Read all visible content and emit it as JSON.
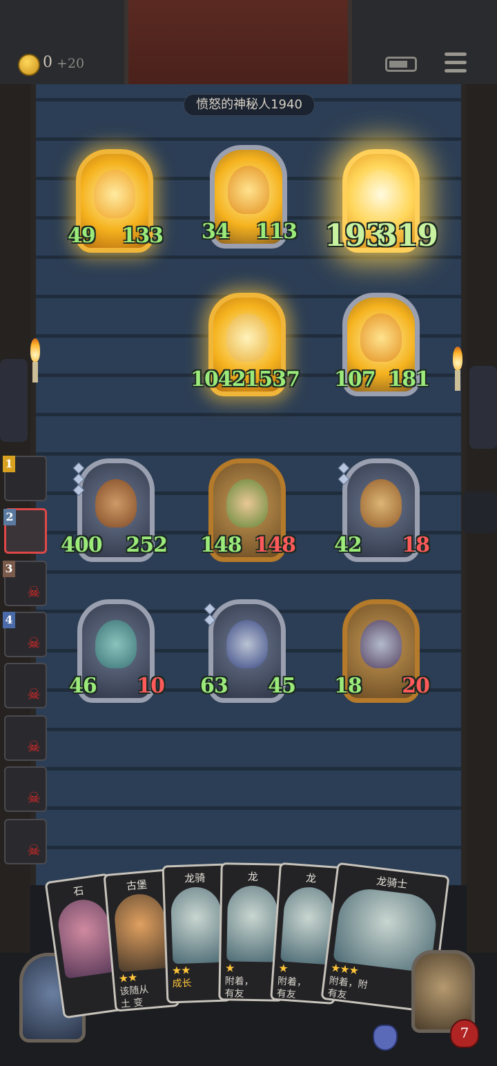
{
  "header": {
    "gold": "0",
    "gold_plus": "+20"
  },
  "opponent": {
    "name": "愤怒的神秘人1940"
  },
  "enemy_row1": [
    {
      "atk": "49",
      "hp": "133"
    },
    {
      "atk": "34",
      "hp": "113"
    },
    {
      "atk": "193",
      "hp": "319"
    }
  ],
  "enemy_row2": [
    {
      "atk": "1042",
      "hp": "1537"
    },
    {
      "atk": "107",
      "hp": "181"
    }
  ],
  "player_row1": [
    {
      "atk": "400",
      "hp": "252"
    },
    {
      "atk": "148",
      "hp": "148"
    },
    {
      "atk": "42",
      "hp": "18"
    }
  ],
  "player_row2": [
    {
      "atk": "46",
      "hp": "10"
    },
    {
      "atk": "63",
      "hp": "45"
    },
    {
      "atk": "18",
      "hp": "20"
    }
  ],
  "roster": [
    {
      "rank": "1"
    },
    {
      "rank": "2"
    },
    {
      "rank": "3"
    },
    {
      "rank": "4"
    },
    {
      "rank": ""
    },
    {
      "rank": ""
    },
    {
      "rank": ""
    },
    {
      "rank": ""
    }
  ],
  "hand": [
    {
      "title": "石",
      "stars": "",
      "desc": ""
    },
    {
      "title": "古堡",
      "stars": "★★",
      "desc": "该随从\n土 变"
    },
    {
      "title": "龙骑",
      "stars": "★★",
      "desc": "成长"
    },
    {
      "title": "龙",
      "stars": "★",
      "desc": "附着，\n有友"
    },
    {
      "title": "龙",
      "stars": "★",
      "desc": "附着，\n有友"
    },
    {
      "title": "龙骑士",
      "stars": "★★★",
      "desc": "附着，附\n有友"
    }
  ],
  "hero": {
    "health": "7"
  },
  "colors": {
    "atk_green": "#9bea7a",
    "hp_red": "#ff5a5a",
    "gold_frame": "#b57a2a",
    "silver_frame": "#9aa0b0"
  }
}
